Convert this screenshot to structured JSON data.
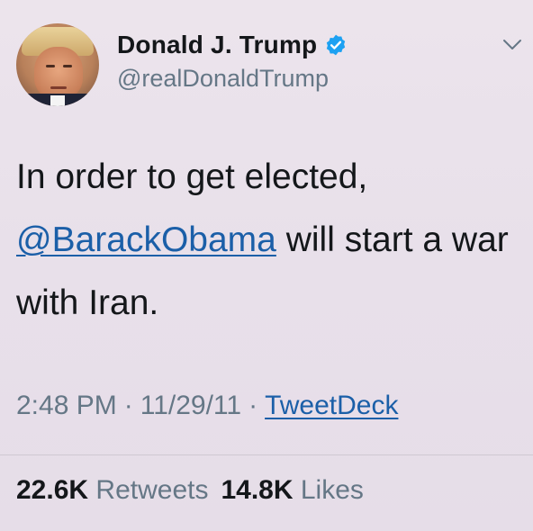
{
  "author": {
    "display_name": "Donald J. Trump",
    "handle": "@realDonaldTrump",
    "verified": true
  },
  "tweet": {
    "text_part1": "In order to get elected,",
    "mention": "@BarackObama",
    "text_part2": " will start a war with Iran."
  },
  "meta": {
    "time": "2:48 PM",
    "separator": "·",
    "date": "11/29/11",
    "source": "TweetDeck"
  },
  "stats": {
    "retweets_count": "22.6K",
    "retweets_label": "Retweets",
    "likes_count": "14.8K",
    "likes_label": "Likes"
  },
  "colors": {
    "link": "#1b5fa8",
    "verified": "#1da1f2",
    "secondary_text": "#657786"
  },
  "icons": {
    "verified": "verified-badge-icon",
    "more": "chevron-down-icon"
  }
}
